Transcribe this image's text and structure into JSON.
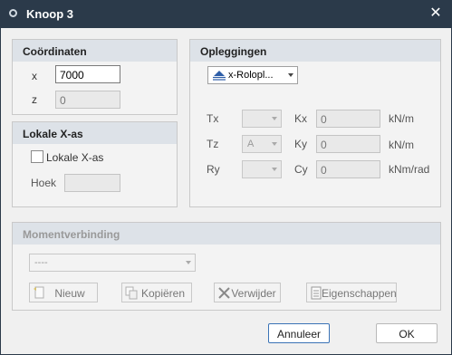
{
  "window": {
    "title": "Knoop 3",
    "close_glyph": "✕"
  },
  "coordinates": {
    "title": "Coördinaten",
    "x_label": "x",
    "x_value": "7000",
    "z_label": "z",
    "z_value": "0"
  },
  "local_axis": {
    "title": "Lokale X-as",
    "checkbox_label": "Lokale X-as",
    "checked": false,
    "angle_label": "Hoek",
    "angle_value": ""
  },
  "supports": {
    "title": "Opleggingen",
    "support_type": "x-Rolopl...",
    "rows": [
      {
        "dof_label": "Tx",
        "dof_value": "",
        "spring_label": "Kx",
        "spring_value": "0",
        "unit": "kN/m"
      },
      {
        "dof_label": "Tz",
        "dof_value": "A",
        "spring_label": "Ky",
        "spring_value": "0",
        "unit": "kN/m"
      },
      {
        "dof_label": "Ry",
        "dof_value": "",
        "spring_label": "Cy",
        "spring_value": "0",
        "unit": "kNm/rad"
      }
    ]
  },
  "moment_connection": {
    "title": "Momentverbinding",
    "selected": "----",
    "buttons": {
      "new": "Nieuw",
      "copy": "Kopiëren",
      "delete": "Verwijder",
      "properties": "Eigenschappen"
    }
  },
  "footer": {
    "cancel": "Annuleer",
    "ok": "OK"
  },
  "colors": {
    "titlebar": "#2b3a4a",
    "group_header": "#dde2e8",
    "primary_border": "#3a73b6"
  }
}
